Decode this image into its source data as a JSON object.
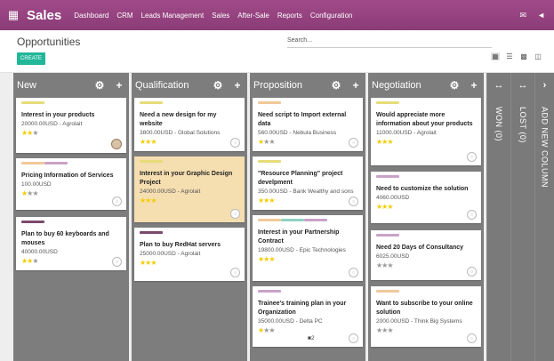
{
  "app": {
    "title": "Sales",
    "menu": [
      "Dashboard",
      "CRM",
      "Leads Management",
      "Sales",
      "After-Sale",
      "Reports",
      "Configuration"
    ]
  },
  "page": {
    "title": "Opportunities",
    "search_placeholder": "Search...",
    "create_label": "CREATE"
  },
  "icons": {
    "apps": "grid-icon",
    "views": [
      "kanban-icon",
      "list-icon",
      "graph-icon",
      "pivot-icon"
    ]
  },
  "columns": [
    {
      "name": "New",
      "cards": [
        {
          "title": "Interest in your products",
          "sub": "20000.00USD - Agrolait",
          "stars": 2,
          "tags": [
            "#e6dc7a"
          ],
          "avatar": "face"
        },
        {
          "title": "Pricing Information of Services",
          "sub": "100.00USD",
          "stars": 1,
          "tags": [
            "#f2c89a",
            "#c9a2c7"
          ]
        },
        {
          "title": "Plan to buy 60 keyboards and mouses",
          "sub": "40000.00USD",
          "stars": 2,
          "tags": [
            "#7a4a6a"
          ]
        }
      ]
    },
    {
      "name": "Qualification",
      "cards": [
        {
          "title": "Need a new design for my website",
          "sub": "3800.00USD - Global Solutions",
          "stars": 3,
          "tags": [
            "#e6dc7a"
          ]
        },
        {
          "title": "Interest in your Graphic Design Project",
          "sub": "24000.00USD - Agrolait",
          "stars": 3,
          "tags": [
            "#e6dc7a"
          ],
          "highlight": true
        },
        {
          "title": "Plan to buy RedHat servers",
          "sub": "25000.00USD - Agrolait",
          "stars": 3,
          "tags": [
            "#7a4a6a"
          ]
        }
      ]
    },
    {
      "name": "Proposition",
      "cards": [
        {
          "title": "Need script to Import external data",
          "sub": "560.00USD - Nebula Business",
          "stars": 1,
          "tags": [
            "#f2c89a"
          ]
        },
        {
          "title": "\"Resource Planning\" project develpment",
          "sub": "350.00USD - Bank Wealthy and sons",
          "stars": 3,
          "tags": [
            "#e6dc7a"
          ]
        },
        {
          "title": "Interest in your Partnership Contract",
          "sub": "19800.00USD - Epic Technologies",
          "stars": 3,
          "tags": [
            "#f2c89a",
            "#8fd0c4",
            "#c9a2c7"
          ]
        },
        {
          "title": "Trainee's training plan in your Organization",
          "sub": "35000.00USD - Delta PC",
          "stars": 1,
          "tags": [
            "#c9a2c7"
          ],
          "messages": "2"
        }
      ]
    },
    {
      "name": "Negotiation",
      "cards": [
        {
          "title": "Would appreciate more information about your products",
          "sub": "11000.00USD - Agrolait",
          "stars": 3,
          "tags": [
            "#e6dc7a"
          ]
        },
        {
          "title": "Need to customize the solution",
          "sub": "4060.00USD",
          "stars": 3,
          "tags": [
            "#c9a2c7"
          ]
        },
        {
          "title": "Need 20 Days of Consultancy",
          "sub": "6025.00USD",
          "stars": 0,
          "tags": [
            "#c9a2c7"
          ]
        },
        {
          "title": "Want to subscribe to your online solution",
          "sub": "2000.00USD - Think Big Systems",
          "stars": 0,
          "tags": [
            "#f2c89a"
          ]
        }
      ]
    }
  ],
  "folded": [
    {
      "label": "WON (0)"
    },
    {
      "label": "LOST (0)"
    },
    {
      "label": "ADD NEW COLUMN"
    }
  ]
}
